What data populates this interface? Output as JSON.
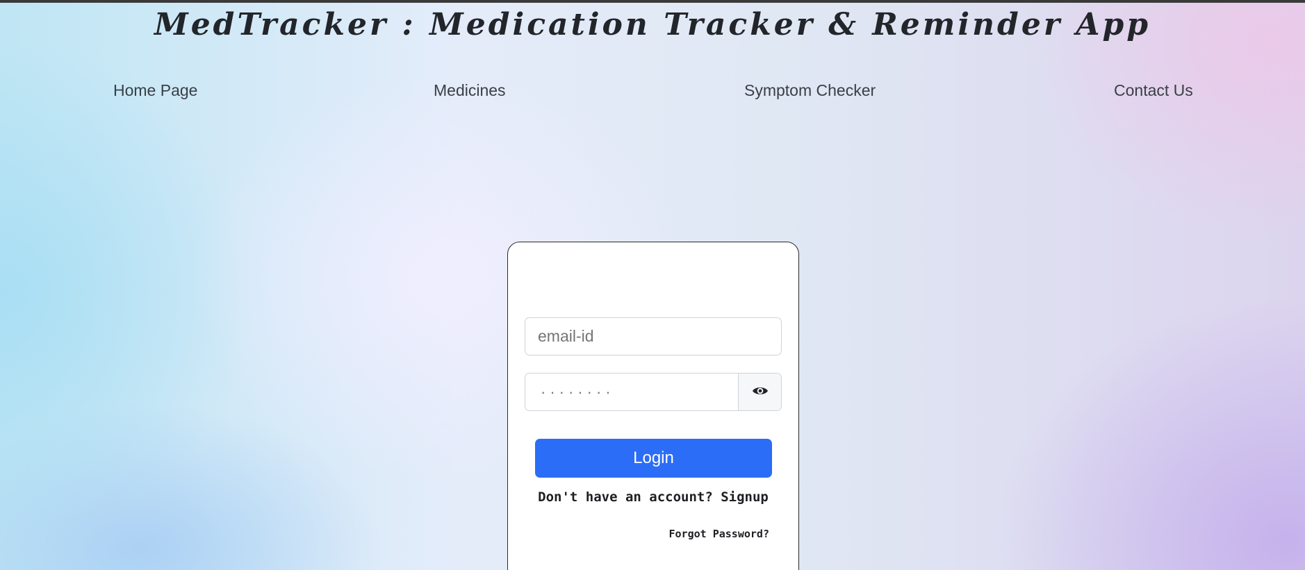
{
  "header": {
    "title": "MedTracker : Medication Tracker & Reminder App"
  },
  "nav": {
    "items": [
      {
        "label": "Home Page"
      },
      {
        "label": "Medicines"
      },
      {
        "label": "Symptom Checker"
      },
      {
        "label": "Contact Us"
      }
    ]
  },
  "login": {
    "email_placeholder": "email-id",
    "password_value": "········",
    "toggle_icon": "eye-icon",
    "login_label": "Login",
    "signup_prefix": "Don't have an account? ",
    "signup_label": "Signup",
    "forgot_label": "Forgot Password?"
  },
  "colors": {
    "primary": "#2b6df6",
    "text": "#1d1f22"
  }
}
